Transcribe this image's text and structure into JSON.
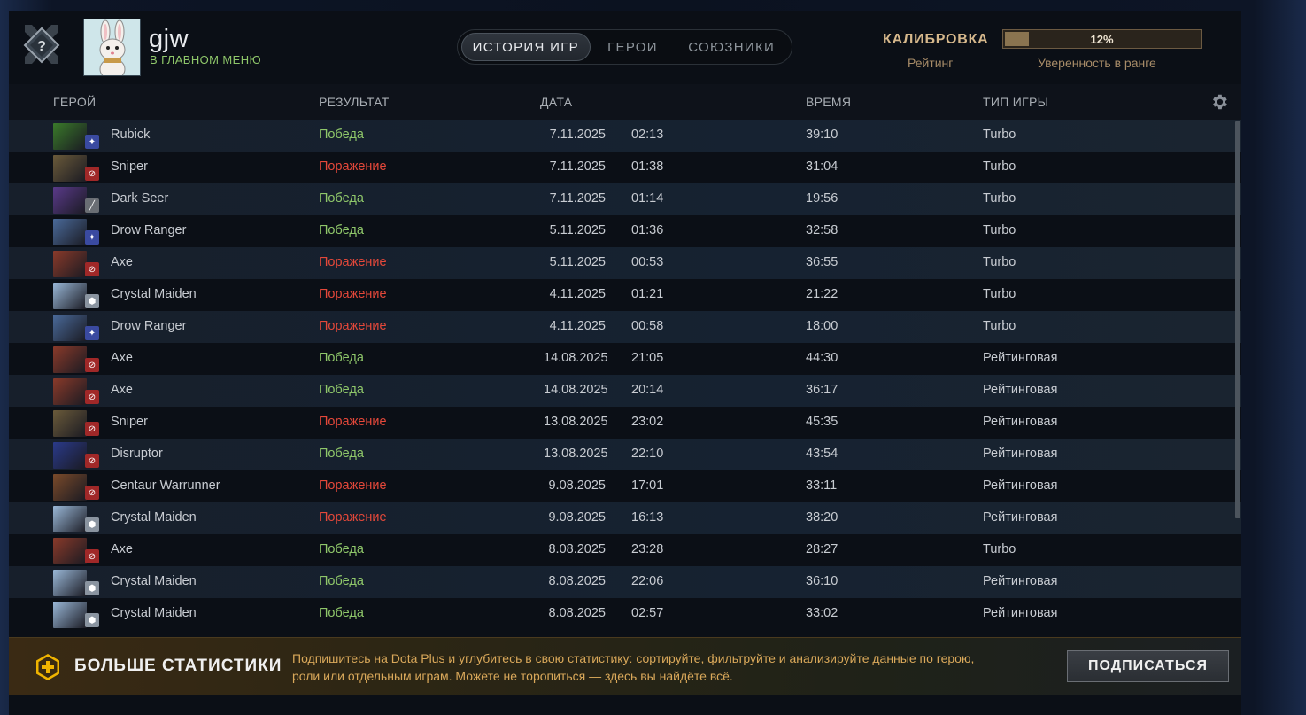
{
  "profile": {
    "name": "gjw",
    "status": "В ГЛАВНОМ МЕНЮ"
  },
  "tabs": [
    {
      "label": "ИСТОРИЯ ИГР",
      "active": true
    },
    {
      "label": "ГЕРОИ",
      "active": false
    },
    {
      "label": "СОЮЗНИКИ",
      "active": false
    }
  ],
  "calibration": {
    "title": "КАЛИБРОВКА",
    "rating_label": "Рейтинг",
    "confidence_label": "Уверенность в ранге",
    "progress_text": "12%",
    "progress": 0.12
  },
  "table": {
    "headers": {
      "hero": "ГЕРОЙ",
      "result": "РЕЗУЛЬТАТ",
      "date": "ДАТА",
      "duration": "ВРЕМЯ",
      "game_type": "ТИП ИГРЫ"
    },
    "rows": [
      {
        "hero": "Rubick",
        "result": "Победа",
        "win": true,
        "date": "7.11.2025",
        "time": "02:13",
        "duration": "39:10",
        "type": "Turbo",
        "role": "mid",
        "color": "#3a7a2a"
      },
      {
        "hero": "Sniper",
        "result": "Поражение",
        "win": false,
        "date": "7.11.2025",
        "time": "01:38",
        "duration": "31:04",
        "type": "Turbo",
        "role": "carry",
        "color": "#6a5a3a"
      },
      {
        "hero": "Dark Seer",
        "result": "Победа",
        "win": true,
        "date": "7.11.2025",
        "time": "01:14",
        "duration": "19:56",
        "type": "Turbo",
        "role": "off",
        "color": "#5a3a8a"
      },
      {
        "hero": "Drow Ranger",
        "result": "Победа",
        "win": true,
        "date": "5.11.2025",
        "time": "01:36",
        "duration": "32:58",
        "type": "Turbo",
        "role": "mid",
        "color": "#4a6a9a"
      },
      {
        "hero": "Axe",
        "result": "Поражение",
        "win": false,
        "date": "5.11.2025",
        "time": "00:53",
        "duration": "36:55",
        "type": "Turbo",
        "role": "carry",
        "color": "#8a3a2a"
      },
      {
        "hero": "Crystal Maiden",
        "result": "Поражение",
        "win": false,
        "date": "4.11.2025",
        "time": "01:21",
        "duration": "21:22",
        "type": "Turbo",
        "role": "support",
        "color": "#9ab8d8"
      },
      {
        "hero": "Drow Ranger",
        "result": "Поражение",
        "win": false,
        "date": "4.11.2025",
        "time": "00:58",
        "duration": "18:00",
        "type": "Turbo",
        "role": "mid",
        "color": "#4a6a9a"
      },
      {
        "hero": "Axe",
        "result": "Победа",
        "win": true,
        "date": "14.08.2025",
        "time": "21:05",
        "duration": "44:30",
        "type": "Рейтинговая",
        "role": "carry",
        "color": "#8a3a2a"
      },
      {
        "hero": "Axe",
        "result": "Победа",
        "win": true,
        "date": "14.08.2025",
        "time": "20:14",
        "duration": "36:17",
        "type": "Рейтинговая",
        "role": "carry",
        "color": "#8a3a2a"
      },
      {
        "hero": "Sniper",
        "result": "Поражение",
        "win": false,
        "date": "13.08.2025",
        "time": "23:02",
        "duration": "45:35",
        "type": "Рейтинговая",
        "role": "carry",
        "color": "#6a5a3a"
      },
      {
        "hero": "Disruptor",
        "result": "Победа",
        "win": true,
        "date": "13.08.2025",
        "time": "22:10",
        "duration": "43:54",
        "type": "Рейтинговая",
        "role": "carry",
        "color": "#2a3a8a"
      },
      {
        "hero": "Centaur Warrunner",
        "result": "Поражение",
        "win": false,
        "date": "9.08.2025",
        "time": "17:01",
        "duration": "33:11",
        "type": "Рейтинговая",
        "role": "carry",
        "color": "#7a4a2a"
      },
      {
        "hero": "Crystal Maiden",
        "result": "Поражение",
        "win": false,
        "date": "9.08.2025",
        "time": "16:13",
        "duration": "38:20",
        "type": "Рейтинговая",
        "role": "support",
        "color": "#9ab8d8"
      },
      {
        "hero": "Axe",
        "result": "Победа",
        "win": true,
        "date": "8.08.2025",
        "time": "23:28",
        "duration": "28:27",
        "type": "Turbo",
        "role": "carry",
        "color": "#8a3a2a"
      },
      {
        "hero": "Crystal Maiden",
        "result": "Победа",
        "win": true,
        "date": "8.08.2025",
        "time": "22:06",
        "duration": "36:10",
        "type": "Рейтинговая",
        "role": "support",
        "color": "#9ab8d8"
      },
      {
        "hero": "Crystal Maiden",
        "result": "Победа",
        "win": true,
        "date": "8.08.2025",
        "time": "02:57",
        "duration": "33:02",
        "type": "Рейтинговая",
        "role": "support",
        "color": "#9ab8d8"
      }
    ]
  },
  "footer": {
    "title": "БОЛЬШЕ СТАТИСТИКИ",
    "text": "Подпишитесь на Dota Plus и углубитесь в свою статистику: сортируйте, фильтруйте и анализируйте данные по герою, роли или отдельным играм. Можете не торопиться — здесь вы найдёте всё.",
    "button": "ПОДПИСАТЬСЯ"
  },
  "colors": {
    "win": "#8fc76a",
    "loss": "#e5483a",
    "accent_gold": "#d6b88c",
    "dota_plus": "#f0b400"
  },
  "icons": {
    "rank": "uncalibrated-rank-icon",
    "settings": "gear-icon",
    "dota_plus": "dota-plus-icon"
  }
}
